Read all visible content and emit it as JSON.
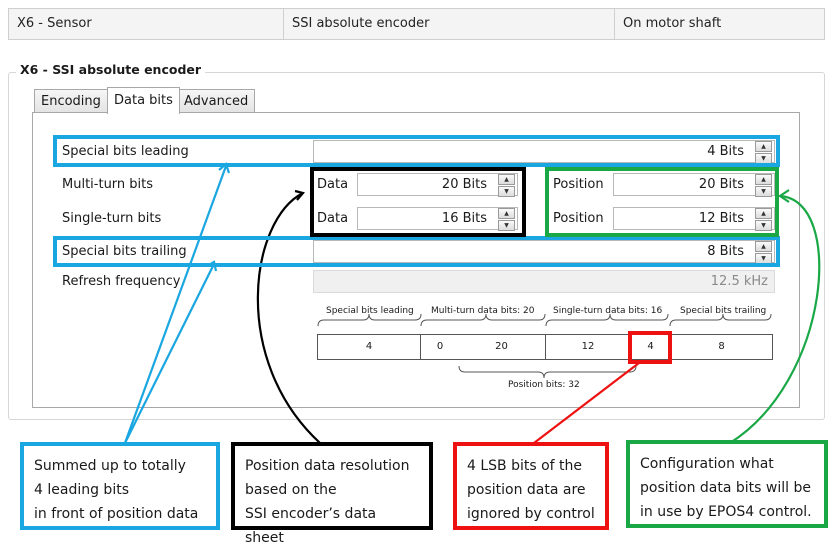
{
  "header": {
    "col1": "X6 - Sensor",
    "col2": "SSI absolute encoder",
    "col3": "On motor shaft"
  },
  "group_title": "X6 - SSI absolute encoder",
  "tabs": [
    {
      "label": "Encoding"
    },
    {
      "label": "Data bits"
    },
    {
      "label": "Advanced"
    }
  ],
  "rows": {
    "special_leading": {
      "label": "Special bits leading",
      "value": "4 Bits"
    },
    "multi_turn": {
      "label": "Multi-turn bits",
      "data_label": "Data",
      "data_value": "20 Bits",
      "pos_label": "Position",
      "pos_value": "20 Bits"
    },
    "single_turn": {
      "label": "Single-turn bits",
      "data_label": "Data",
      "data_value": "16 Bits",
      "pos_label": "Position",
      "pos_value": "12 Bits"
    },
    "special_trailing": {
      "label": "Special bits trailing",
      "value": "8 Bits"
    },
    "refresh": {
      "label": "Refresh frequency",
      "value": "12.5 kHz"
    }
  },
  "diagram": {
    "top_labels": [
      "Special bits leading",
      "Multi-turn data bits: 20",
      "Single-turn data bits: 16",
      "Special bits trailing"
    ],
    "cells": [
      "4",
      "0",
      "20",
      "12",
      "4",
      "8"
    ],
    "bottom_label": "Position bits: 32"
  },
  "callouts": {
    "blue": [
      "Summed up to totally",
      "4 leading bits",
      "in front of position data"
    ],
    "black": [
      "Position data resolution",
      "based on the",
      "SSI encoder’s data sheet"
    ],
    "red": [
      "4 LSB bits of the",
      "position data are",
      "ignored by control"
    ],
    "green": [
      "Configuration what",
      "position data bits will be",
      "in use by EPOS4 control."
    ]
  },
  "colors": {
    "blue": "#1aa6e0",
    "black": "#000000",
    "red": "#ee1111",
    "green": "#1aa847"
  }
}
